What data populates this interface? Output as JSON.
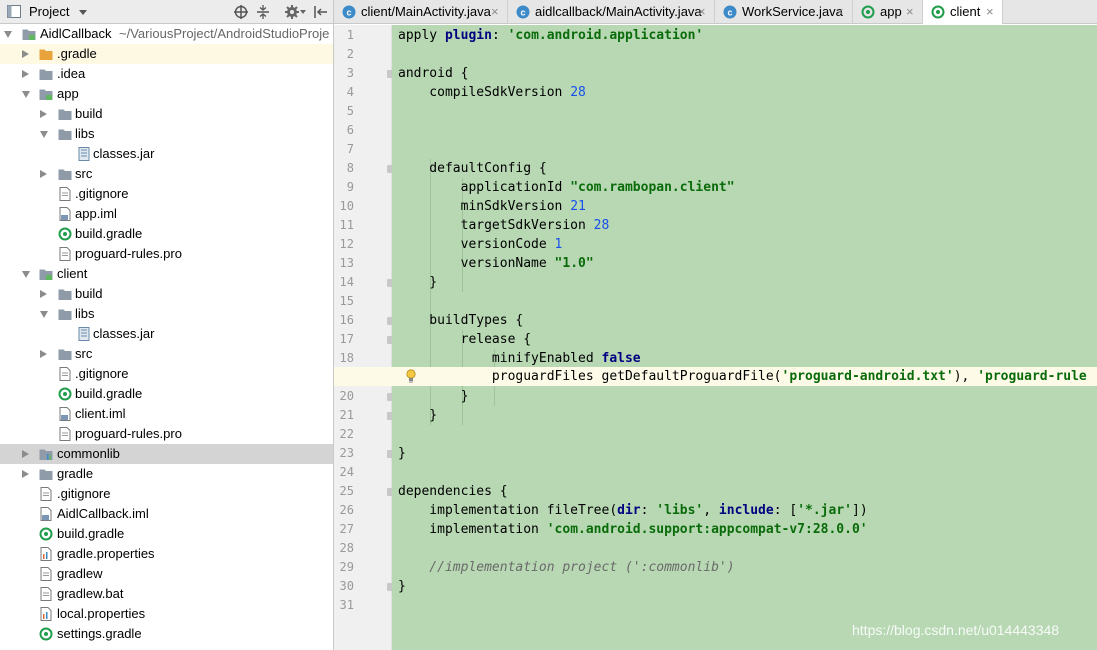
{
  "project_pane": {
    "title": "Project",
    "tree": [
      {
        "label": "AidlCallback",
        "path": "~/VariousProject/AndroidStudioProje",
        "icon": "module-folder-icon"
      },
      {
        "label": ".gradle",
        "icon": "orange-folder-icon"
      },
      {
        "label": ".idea",
        "icon": "folder-icon"
      },
      {
        "label": "app",
        "icon": "module-folder-icon"
      },
      {
        "label": "build",
        "icon": "folder-icon"
      },
      {
        "label": "libs",
        "icon": "folder-icon"
      },
      {
        "label": "classes.jar",
        "icon": "jar-icon"
      },
      {
        "label": "src",
        "icon": "folder-icon"
      },
      {
        "label": ".gitignore",
        "icon": "file-icon"
      },
      {
        "label": "app.iml",
        "icon": "iml-file-icon"
      },
      {
        "label": "build.gradle",
        "icon": "gradle-icon"
      },
      {
        "label": "proguard-rules.pro",
        "icon": "file-icon"
      },
      {
        "label": "client",
        "icon": "module-folder-icon"
      },
      {
        "label": "build",
        "icon": "folder-icon"
      },
      {
        "label": "libs",
        "icon": "folder-icon"
      },
      {
        "label": "classes.jar",
        "icon": "jar-icon"
      },
      {
        "label": "src",
        "icon": "folder-icon"
      },
      {
        "label": ".gitignore",
        "icon": "file-icon"
      },
      {
        "label": "build.gradle",
        "icon": "gradle-icon"
      },
      {
        "label": "client.iml",
        "icon": "iml-file-icon"
      },
      {
        "label": "proguard-rules.pro",
        "icon": "file-icon"
      },
      {
        "label": "commonlib",
        "icon": "library-folder-icon"
      },
      {
        "label": "gradle",
        "icon": "folder-icon"
      },
      {
        "label": ".gitignore",
        "icon": "file-icon"
      },
      {
        "label": "AidlCallback.iml",
        "icon": "iml-file-icon"
      },
      {
        "label": "build.gradle",
        "icon": "gradle-icon"
      },
      {
        "label": "gradle.properties",
        "icon": "properties-icon"
      },
      {
        "label": "gradlew",
        "icon": "file-icon"
      },
      {
        "label": "gradlew.bat",
        "icon": "file-icon"
      },
      {
        "label": "local.properties",
        "icon": "properties-icon"
      },
      {
        "label": "settings.gradle",
        "icon": "gradle-icon"
      }
    ]
  },
  "tabs": [
    {
      "label": "client/MainActivity.java",
      "icon": "class-icon",
      "active": false
    },
    {
      "label": "aidlcallback/MainActivity.java",
      "icon": "class-icon",
      "active": false
    },
    {
      "label": "WorkService.java",
      "icon": "class-icon",
      "active": false
    },
    {
      "label": "app",
      "icon": "gradle-icon",
      "active": false
    },
    {
      "label": "client",
      "icon": "gradle-icon",
      "active": true
    }
  ],
  "editor": {
    "line_numbers": [
      "1",
      "2",
      "3",
      "4",
      "5",
      "6",
      "7",
      "8",
      "9",
      "10",
      "11",
      "12",
      "13",
      "14",
      "15",
      "16",
      "17",
      "18",
      "19",
      "20",
      "21",
      "22",
      "23",
      "24",
      "25",
      "26",
      "27",
      "28",
      "29",
      "30",
      "31"
    ],
    "tokens": {
      "l1_a": "apply ",
      "l1_b": "plugin",
      "l1_c": ": ",
      "l1_d": "'com.android.application'",
      "l3": "android {",
      "l4_a": "    compileSdkVersion ",
      "l4_b": "28",
      "l8": "    defaultConfig {",
      "l9_a": "        applicationId ",
      "l9_b": "\"com.rambopan.client\"",
      "l10_a": "        minSdkVersion ",
      "l10_b": "21",
      "l11_a": "        targetSdkVersion ",
      "l11_b": "28",
      "l12_a": "        versionCode ",
      "l12_b": "1",
      "l13_a": "        versionName ",
      "l13_b": "\"1.0\"",
      "l14": "    }",
      "l16": "    buildTypes {",
      "l17": "        release {",
      "l18_a": "            minifyEnabled ",
      "l18_b": "false",
      "l19_a": "            proguardFiles getDefaultProguardFile(",
      "l19_b": "'proguard-android.txt'",
      "l19_c": "), ",
      "l19_d": "'proguard-rule",
      "l20": "        }",
      "l21": "    }",
      "l23": "}",
      "l25": "dependencies {",
      "l26_a": "    implementation fileTree(",
      "l26_b": "dir",
      "l26_c": ": ",
      "l26_d": "'libs'",
      "l26_e": ", ",
      "l26_f": "include",
      "l26_g": ": [",
      "l26_h": "'*.jar'",
      "l26_i": "])",
      "l27_a": "    implementation ",
      "l27_b": "'com.android.support:appcompat-v7:28.0.0'",
      "l29": "    //implementation project (':commonlib')",
      "l30": "}"
    }
  },
  "watermark": "https://blog.csdn.net/u014443348",
  "colors": {
    "editor_bg": "#b7d8b3",
    "gutter_bg": "#f0f0f0",
    "current_line": "#fdfbe8",
    "selected_row": "#d4d4d4",
    "gradle_dir_row": "#fdf9e3"
  }
}
